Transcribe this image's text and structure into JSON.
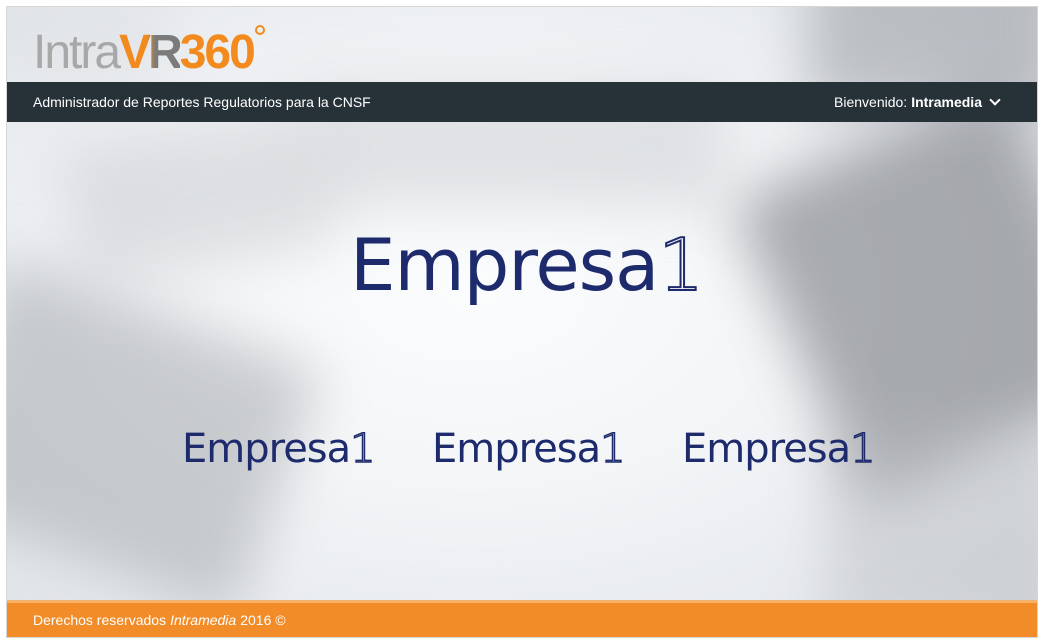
{
  "logo": {
    "part1": "Intra",
    "part2": "VR",
    "part3": "360"
  },
  "header": {
    "title": "Administrador de Reportes Regulatorios para la CNSF",
    "welcome_label": "Bienvenido:",
    "user_name": "Intramedia"
  },
  "main": {
    "company": {
      "name": "Empresa",
      "suffix": "1"
    },
    "company_options": [
      {
        "name": "Empresa",
        "suffix": "1"
      },
      {
        "name": "Empresa",
        "suffix": "1"
      },
      {
        "name": "Empresa",
        "suffix": "1"
      }
    ]
  },
  "footer": {
    "prefix": "Derechos reservados",
    "brand": "Intramedia",
    "suffix": "2016 ©"
  },
  "colors": {
    "header_bg": "#263238",
    "footer_bg": "#f28c28",
    "brand_orange": "#f28a1e",
    "company_blue": "#1d2a6b"
  }
}
